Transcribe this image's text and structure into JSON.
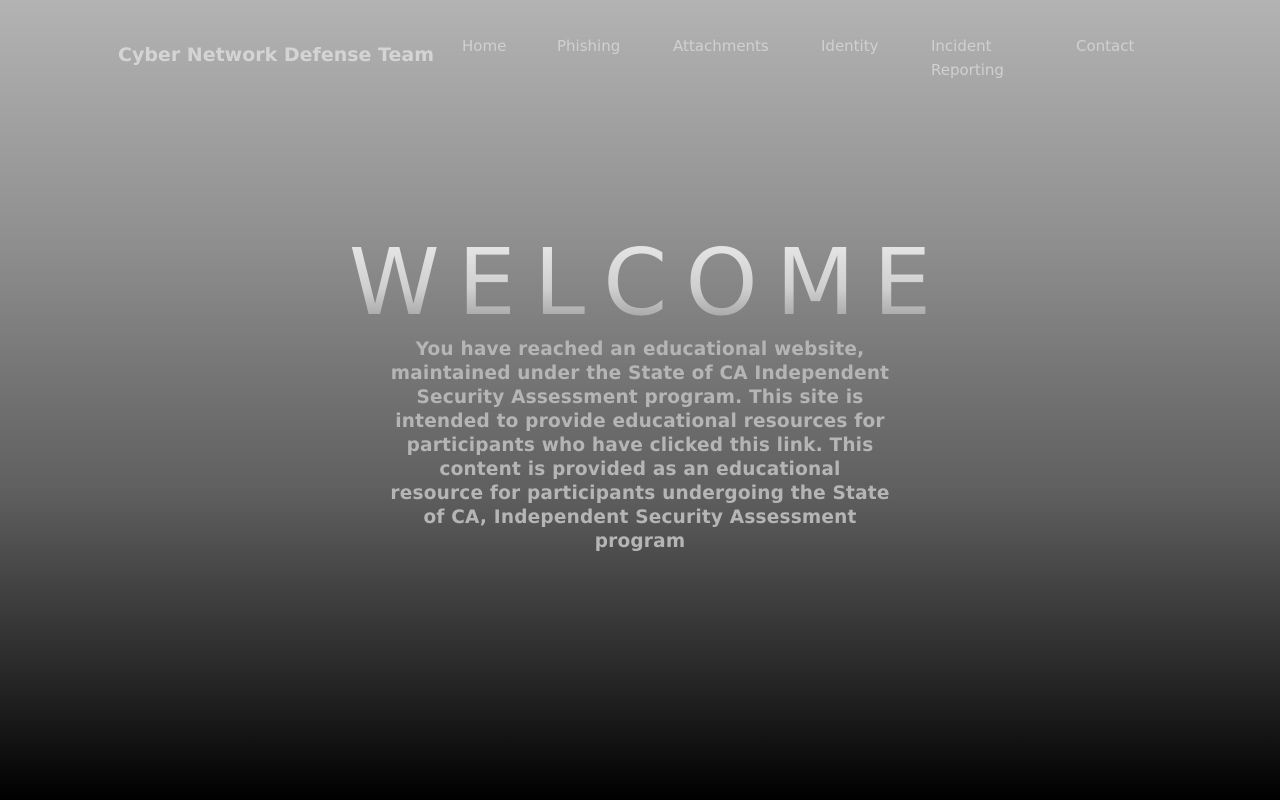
{
  "header": {
    "brand": "Cyber Network Defense Team",
    "nav": [
      {
        "label": "Home"
      },
      {
        "label": "Phishing"
      },
      {
        "label": "Attachments"
      },
      {
        "label": "Identity"
      },
      {
        "label": "Incident Reporting"
      },
      {
        "label": "Contact"
      }
    ]
  },
  "hero": {
    "title": "WELCOME",
    "text": "You have reached an educational website, maintained under the State of CA Independent Security Assessment program. This site is intended to provide educational resources for participants who have clicked this link. This content is provided as an educational resource for participants undergoing the State of CA, Independent Security Assessment program"
  },
  "colors": {
    "background_top": "#b3b3b3",
    "background_bottom": "#000000",
    "nav_text": "#d0d0d0",
    "body_text": "#b5b5b5"
  }
}
